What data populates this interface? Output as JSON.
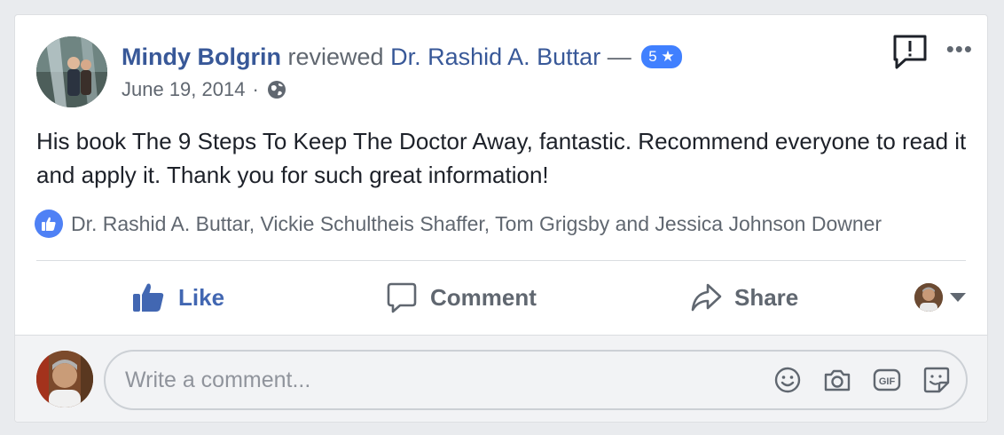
{
  "review": {
    "reviewer": "Mindy Bolgrin",
    "action": "reviewed",
    "subject": "Dr. Rashid A. Buttar",
    "separator": "—",
    "rating_label": "5 ★",
    "date": "June 19, 2014",
    "dot": "·",
    "audience_icon": "globe-icon",
    "text": "His book The 9 Steps To Keep The Doctor Away, fantastic. Recommend everyone to read it and apply it. Thank you for such great information!"
  },
  "reactions": {
    "icon": "like-badge-icon",
    "likers": "Dr. Rashid A. Buttar, Vickie Schultheis Shaffer, Tom Grigsby and Jessica Johnson Downer"
  },
  "actions": {
    "like_label": "Like",
    "comment_label": "Comment",
    "share_label": "Share"
  },
  "comment_box": {
    "placeholder": "Write a comment...",
    "icons": [
      "emoji-icon",
      "camera-icon",
      "gif-icon",
      "sticker-icon"
    ]
  },
  "colors": {
    "link": "#385898",
    "like_blue": "#4267b2",
    "rating_badge": "#4080ff",
    "muted": "#606770"
  }
}
